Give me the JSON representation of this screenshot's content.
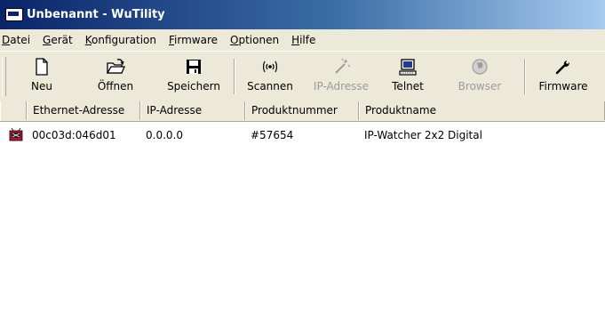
{
  "window": {
    "title": "Unbenannt - WuTility"
  },
  "menu": [
    {
      "pre": "",
      "u": "D",
      "post": "atei"
    },
    {
      "pre": "",
      "u": "G",
      "post": "erät"
    },
    {
      "pre": "",
      "u": "K",
      "post": "onfiguration"
    },
    {
      "pre": "",
      "u": "F",
      "post": "irmware"
    },
    {
      "pre": "",
      "u": "O",
      "post": "ptionen"
    },
    {
      "pre": "",
      "u": "H",
      "post": "ilfe"
    }
  ],
  "toolbar": {
    "new_label": "Neu",
    "open_label": "Öffnen",
    "save_label": "Speichern",
    "scan_label": "Scannen",
    "ip_label": "IP-Adresse",
    "telnet_label": "Telnet",
    "browser_label": "Browser",
    "firmware_label": "Firmware"
  },
  "list": {
    "columns": [
      "Ethernet-Adresse",
      "IP-Adresse",
      "Produktnummer",
      "Produktname"
    ],
    "rows": [
      {
        "mac": "00c03d:046d01",
        "ip": "0.0.0.0",
        "product_number": "#57654",
        "product_name": "IP-Watcher 2x2 Digital"
      }
    ]
  },
  "colors": {
    "title_start": "#0a246a",
    "title_end": "#a6caf0",
    "chrome": "#ece9d8",
    "row_icon": "#c0103a"
  }
}
